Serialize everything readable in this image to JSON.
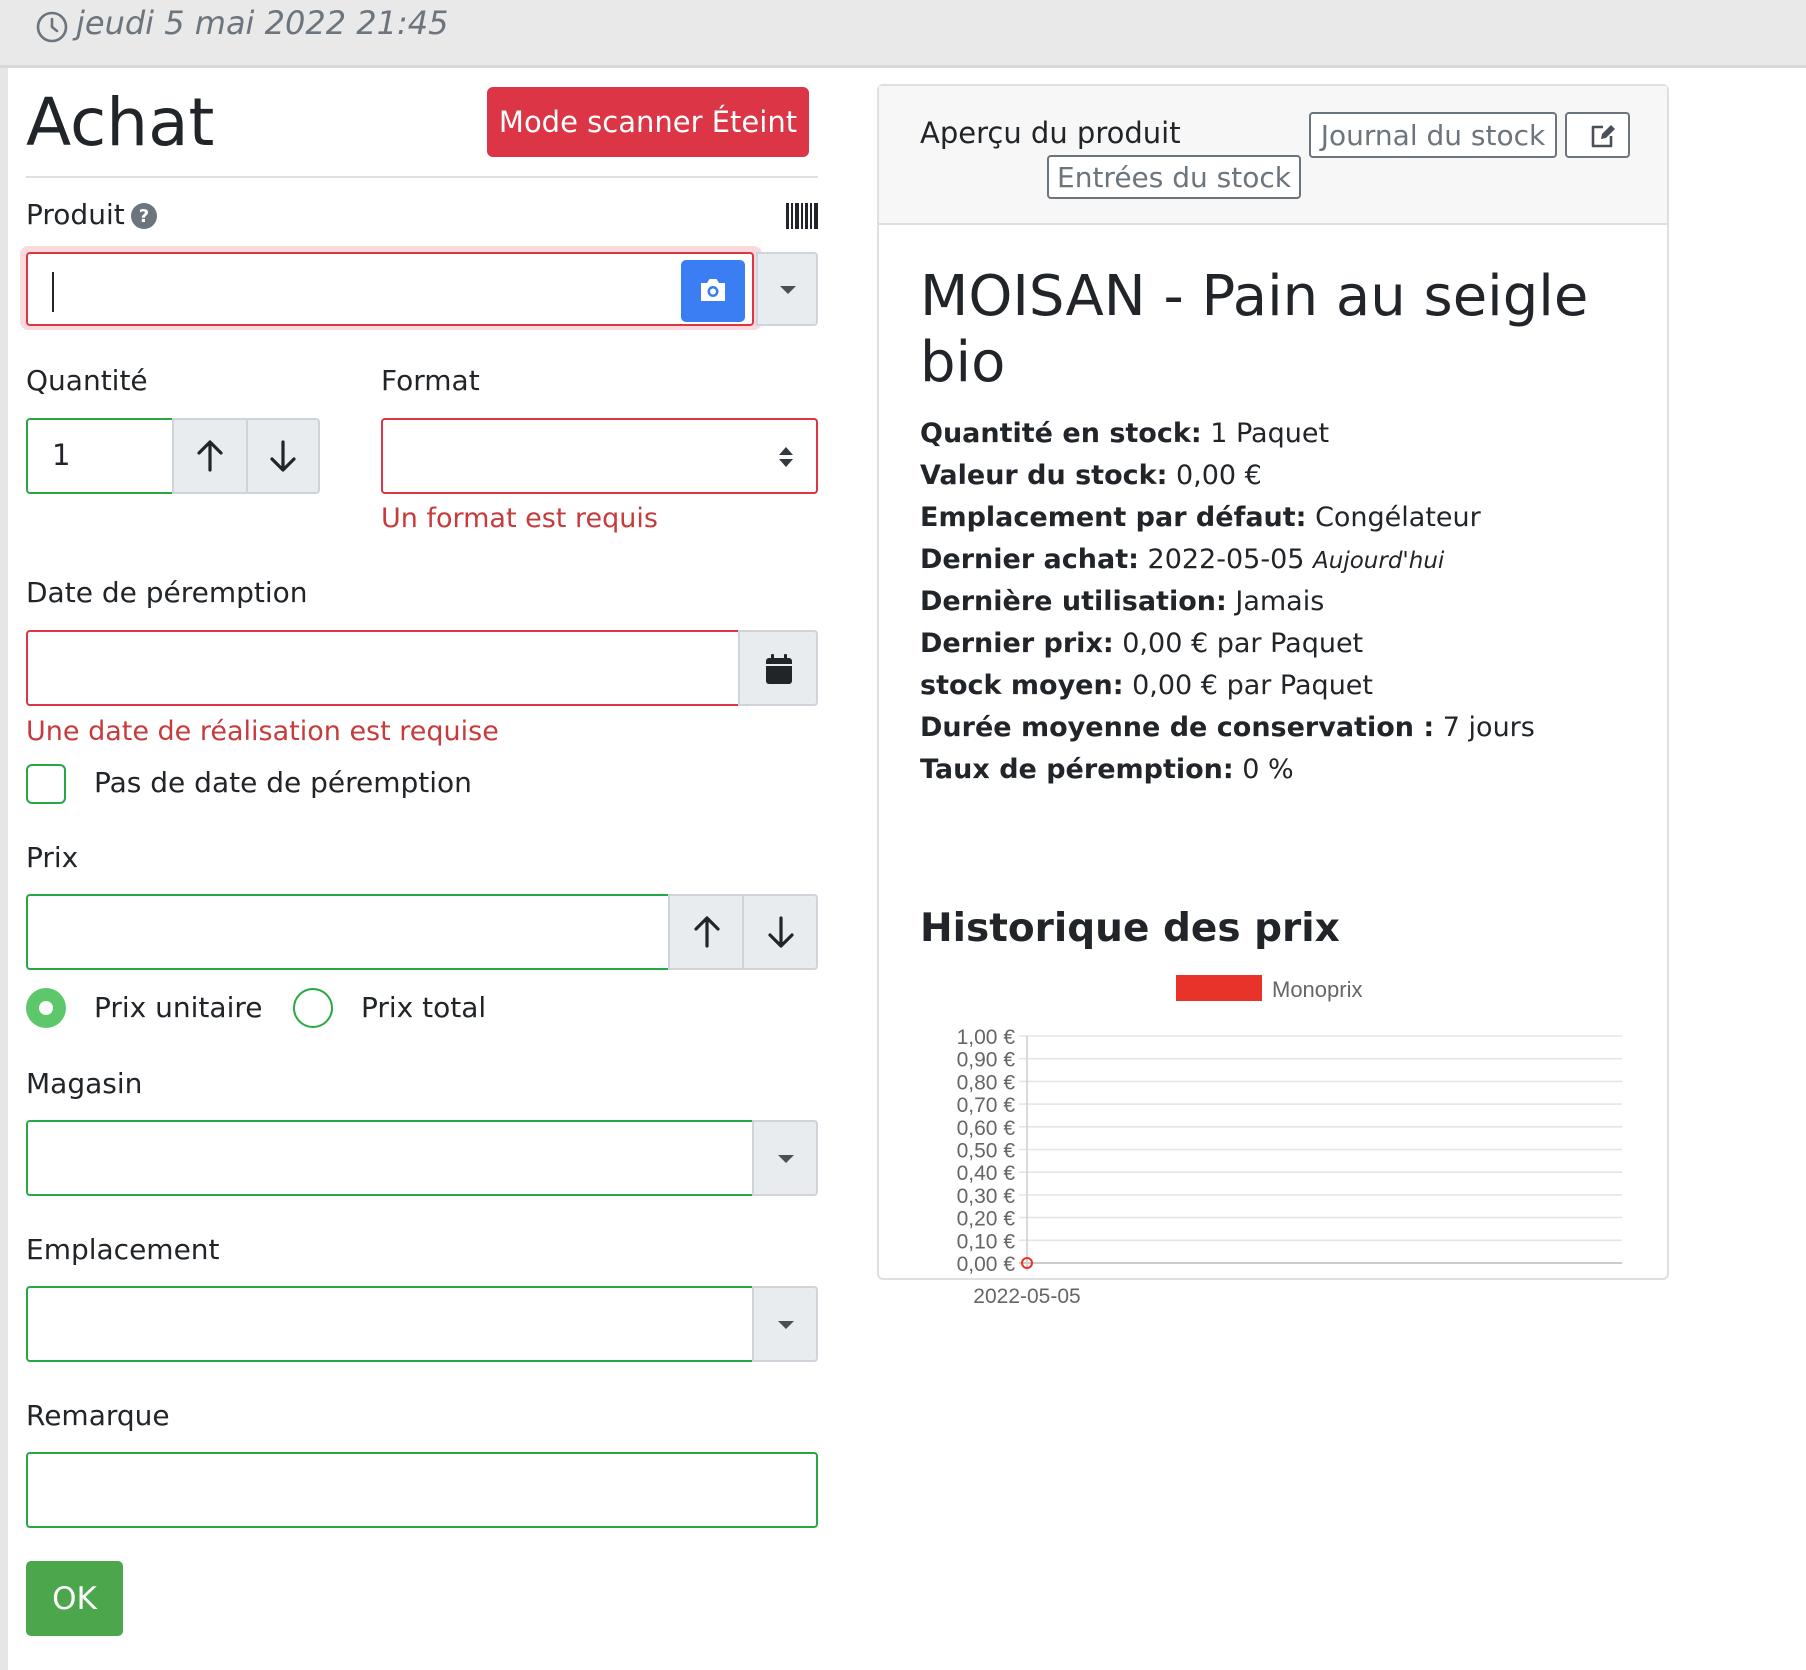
{
  "header": {
    "datetime": "jeudi 5 mai 2022 21:45"
  },
  "form": {
    "title": "Achat",
    "scanner_button": "Mode scanner Éteint",
    "product": {
      "label": "Produit",
      "value": ""
    },
    "quantity": {
      "label": "Quantité",
      "value": "1"
    },
    "format": {
      "label": "Format",
      "selected": "",
      "error": "Un format est requis"
    },
    "best_before": {
      "label": "Date de péremption",
      "value": "",
      "error": "Une date de réalisation est requise",
      "no_date_label": "Pas de date de péremption",
      "no_date_checked": false
    },
    "price": {
      "label": "Prix",
      "value": "",
      "unit_label": "Prix unitaire",
      "total_label": "Prix total",
      "mode": "unit"
    },
    "store": {
      "label": "Magasin",
      "selected": ""
    },
    "location": {
      "label": "Emplacement",
      "selected": ""
    },
    "note": {
      "label": "Remarque",
      "value": ""
    },
    "submit": "OK"
  },
  "card": {
    "header_label": "Aperçu du produit",
    "stock_journal_button": "Journal du stock",
    "stock_entries_button": "Entrées du stock",
    "product_name": "MOISAN - Pain au seigle bio",
    "info": [
      {
        "key": "Quantité en stock:",
        "value": "1 Paquet"
      },
      {
        "key": "Valeur du stock:",
        "value": "0,00 €"
      },
      {
        "key": "Emplacement par défaut:",
        "value": "Congélateur"
      },
      {
        "key": "Dernier achat:",
        "value": "2022-05-05",
        "relative": "Aujourd'hui"
      },
      {
        "key": "Dernière utilisation:",
        "value": "Jamais"
      },
      {
        "key": "Dernier prix:",
        "value": "0,00 € par Paquet"
      },
      {
        "key": "stock moyen:",
        "value": "0,00 € par Paquet"
      },
      {
        "key": "Durée moyenne de conservation :",
        "value": "7 jours"
      },
      {
        "key": "Taux de péremption:",
        "value": "0 %"
      }
    ],
    "history_title": "Historique des prix"
  },
  "chart_data": {
    "type": "line",
    "title": "",
    "xlabel": "",
    "ylabel": "",
    "ylim": [
      0,
      1.0
    ],
    "y_ticks": [
      "1,00 €",
      "0,90 €",
      "0,80 €",
      "0,70 €",
      "0,60 €",
      "0,50 €",
      "0,40 €",
      "0,30 €",
      "0,20 €",
      "0,10 €",
      "0,00 €"
    ],
    "categories": [
      "2022-05-05"
    ],
    "series": [
      {
        "name": "Monoprix",
        "color": "#e8332a",
        "values": [
          0.0
        ]
      }
    ],
    "legend": "top",
    "grid": true
  }
}
